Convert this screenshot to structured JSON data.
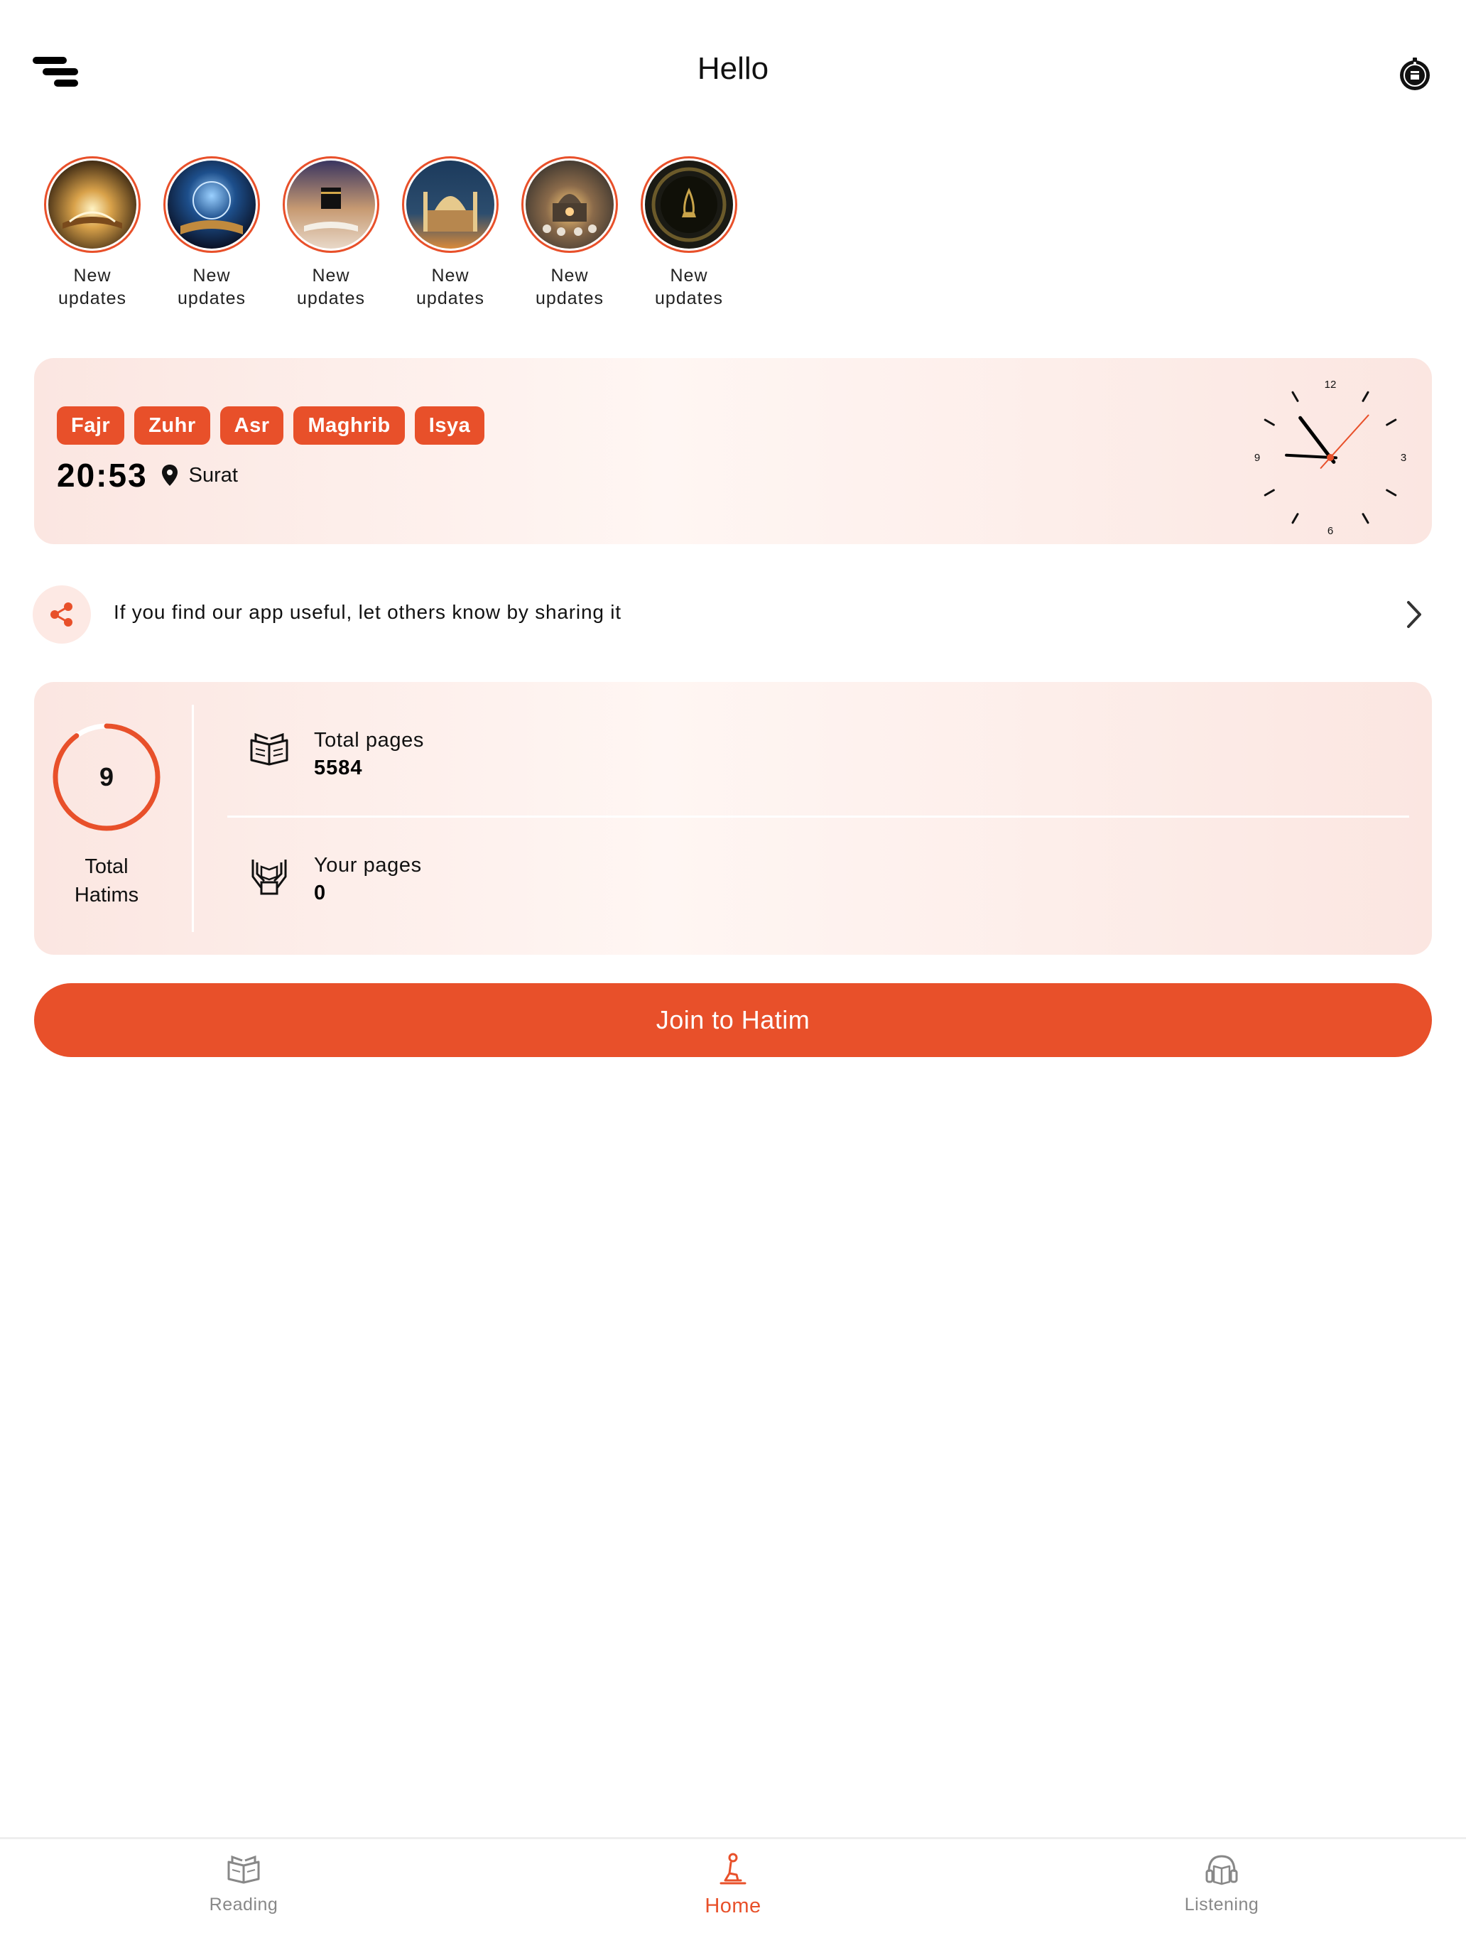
{
  "header": {
    "title": "Hello",
    "menu_icon": "menu-icon",
    "qibla_icon": "qibla-compass-icon"
  },
  "stories": [
    {
      "label": "New\nupdates",
      "theme": "glowing-quran"
    },
    {
      "label": "New\nupdates",
      "theme": "cosmic-book"
    },
    {
      "label": "New\nupdates",
      "theme": "kaaba"
    },
    {
      "label": "New\nupdates",
      "theme": "mosque-night"
    },
    {
      "label": "New\nupdates",
      "theme": "crowd-mosque"
    },
    {
      "label": "New\nupdates",
      "theme": "calligraphy"
    }
  ],
  "prayer": {
    "names": [
      "Fajr",
      "Zuhr",
      "Asr",
      "Maghrib",
      "Isya"
    ],
    "time": "20:53",
    "city": "Surat",
    "clock": {
      "numerals": [
        "12",
        "3",
        "6",
        "9"
      ],
      "hour": 10,
      "minute": 45.5,
      "second": 7
    }
  },
  "share": {
    "text": "If you find our app useful, let others know by sharing it"
  },
  "hatim": {
    "count": "9",
    "label": "Total\nHatims",
    "progress": 0.9,
    "total_pages_label": "Total pages",
    "total_pages_value": "5584",
    "your_pages_label": "Your pages",
    "your_pages_value": "0"
  },
  "join_button": "Join to Hatim",
  "nav": [
    {
      "label": "Reading",
      "icon": "open-book-icon",
      "active": false
    },
    {
      "label": "Home",
      "icon": "praying-person-icon",
      "active": true
    },
    {
      "label": "Listening",
      "icon": "headphones-book-icon",
      "active": false
    }
  ],
  "colors": {
    "accent": "#e8502a",
    "card_bg": "#fbe6e1",
    "nav_inactive": "#888888"
  }
}
